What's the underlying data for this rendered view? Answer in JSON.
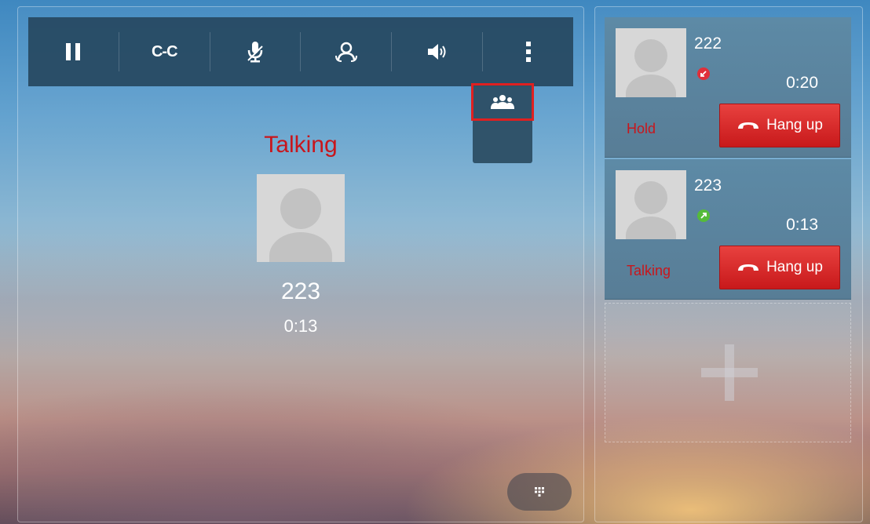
{
  "toolbar": {
    "buttons": [
      {
        "name": "hold",
        "label": "II",
        "icon": "pause-icon"
      },
      {
        "name": "transfer",
        "label": "C-C",
        "icon": "transfer-icon"
      },
      {
        "name": "mute",
        "label": "",
        "icon": "microphone-icon"
      },
      {
        "name": "conference",
        "label": "",
        "icon": "people-icon"
      },
      {
        "name": "speaker",
        "label": "",
        "icon": "speaker-icon"
      },
      {
        "name": "more",
        "label": "⋮",
        "icon": "more-icon"
      }
    ]
  },
  "dropdown": {
    "item_icon": "conference-icon",
    "highlight_color": "#e02020"
  },
  "main_call": {
    "status": "Talking",
    "number": "223",
    "duration": "0:13",
    "avatar_icon": "contact-avatar-icon"
  },
  "calls": [
    {
      "number": "222",
      "duration": "0:20",
      "status": "Hold",
      "hangup_label": "Hang up",
      "indicator": "incoming-call-icon",
      "indicator_color": "#e0303a"
    },
    {
      "number": "223",
      "duration": "0:13",
      "status": "Talking",
      "hangup_label": "Hang up",
      "indicator": "outgoing-call-icon",
      "indicator_color": "#55bb3a"
    }
  ],
  "add_slot": {
    "icon": "plus-icon"
  },
  "keypad": {
    "icon": "dialpad-icon"
  },
  "colors": {
    "status_red": "#c8161c",
    "toolbar_bg": "#264860",
    "hangup_red": "#d0292a"
  }
}
